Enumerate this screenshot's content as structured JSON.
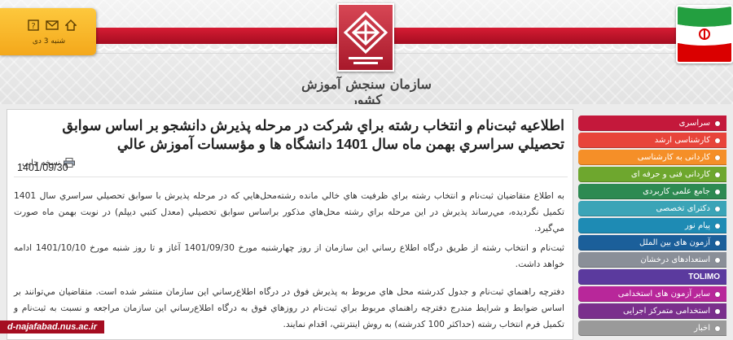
{
  "header": {
    "org_name": "سازمان سنجش آموزش کشور",
    "date_label": "شنبه 3 دی",
    "icons": [
      "help-icon",
      "mail-icon",
      "home-icon"
    ]
  },
  "colors": {
    "brand_red": "#c0152b",
    "info_box": "#f8b72c"
  },
  "article": {
    "title": "اطلاعيه ثبت‌نام و انتخاب رشته براي شركت در مرحله پذيرش دانشجو بر اساس سوابق تحصيلي سراسري بهمن ماه سال 1401 دانشگاه ها و مؤسسات آموزش عالي",
    "print_label": "نسخه چاپی",
    "date": "1401/09/30",
    "paragraphs": [
      "به اطلاع متقاضيان ثبت‌نام و انتخاب رشته‌ براي ظرفيت هاي خالي مانده رشته‌محل‌هايي كه در مرحله پذيرش با سوابق تحصيلي سراسري سال 1401 تكميل نگرديده، مي‌رساند پذيرش در اين مرحله براي رشته محل‌هاي مذكور براساس سوابق تحصيلي (معدل كتبي ديپلم) در نوبت بهمن ماه صورت مي‌گيرد.",
      "ثبت‌نام و انتخاب رشته از طريق درگاه اطلاع رساني اين سازمان از روز چهارشنبه مورخ 1401/09/30 آغاز و تا روز شنبه مورخ 1401/10/10 ادامه خواهد داشت.",
      "دفترچه راهنماي ثبت‌نام و جدول كدرشته محل هاي مربوط به پذيرش فوق در درگاه اطلاع‌رساني اين سازمان منتشر شده است. متقاضيان مي‌توانند بر اساس ضوابط و شرايط مندرج دفترچه راهنماي مربوط براي ثبت‌نام در روزهاي فوق به درگاه اطلاع‌رساني اين سازمان مراجعه و نسبت به ثبت‌نام و تكميل فرم انتخاب رشته (حداكثر 100 كدرشته) به روش اينترنتي، اقدام نمايند."
    ]
  },
  "source_tag": "d-najafabad.nus.ac.ir",
  "menu": [
    {
      "label": "سراسری",
      "color": "#c4183b"
    },
    {
      "label": "کارشناسی ارشد",
      "color": "#e8443a"
    },
    {
      "label": "کاردانی به کارشناسی",
      "color": "#f58f28"
    },
    {
      "label": "کاردانی فنی و حرفه ای",
      "color": "#6ea72e"
    },
    {
      "label": "جامع علمی کاربردی",
      "color": "#2d8a52"
    },
    {
      "label": "دکترای تخصصی",
      "color": "#3ba4b7"
    },
    {
      "label": "پیام نور",
      "color": "#1e8bb4"
    },
    {
      "label": "آزمون های بین الملل",
      "color": "#1b5f9a"
    },
    {
      "label": "استعدادهای درخشان",
      "color": "#8a8f98"
    },
    {
      "label": "TOLIMO",
      "color": "#5b3a9e"
    },
    {
      "label": "سایر آزمون های استخدامی",
      "color": "#b8279a"
    },
    {
      "label": "استخدامی متمرکز اجرایی",
      "color": "#7a2f8c"
    },
    {
      "label": "اخبار",
      "color": "#9a9a9a"
    }
  ]
}
